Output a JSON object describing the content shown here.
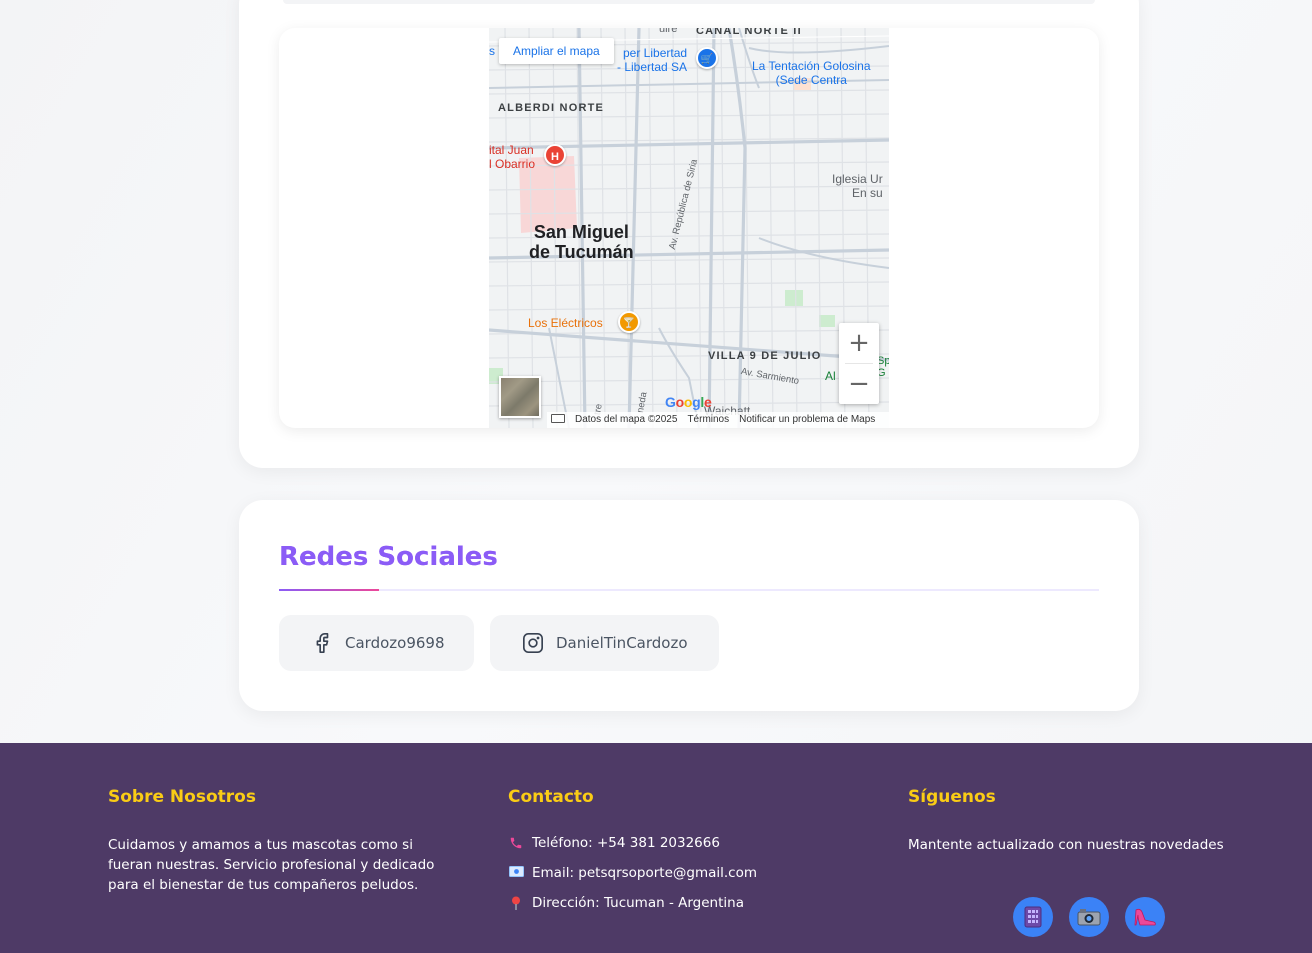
{
  "map": {
    "expand_label": "Ampliar el mapa",
    "labels": {
      "canal_norte": "CANAL NORTE II",
      "super_libertad": "per Libertad\n- Libertad SA",
      "tentacion": "La Tentación Golosina\n(Sede Centra",
      "alberdi_norte": "ALBERDI NORTE",
      "hospital": "ital Juan\nl Obarrio",
      "city": "San Miguel\nde Tucumán",
      "iglesia": "Iglesia Ur\nEn su",
      "republica_siria": "Av. República de Siria",
      "los_electricos": "Los Eléctricos",
      "villa_9_julio": "VILLA 9 DE JULIO",
      "sarmiento": "Av. Sarmiento",
      "al": "Al",
      "waichatt": "Waichatt",
      "sp": "Sp\nG",
      "tre": "tre",
      "neda": "neda",
      "s_left": "s",
      "top_guire": "uire"
    },
    "pins": {
      "hospital": "H",
      "shop": "🛒",
      "bar": "🍸"
    },
    "zoom_in": "+",
    "zoom_out": "−",
    "google_logo": "Google",
    "attribution": {
      "map_data": "Datos del mapa ©2025",
      "terms": "Términos",
      "report": "Notificar un problema de Maps"
    }
  },
  "social": {
    "title": "Redes Sociales",
    "facebook": {
      "label": "Cardozo9698",
      "icon": "facebook-icon"
    },
    "instagram": {
      "label": "DanielTinCardozo",
      "icon": "instagram-icon"
    }
  },
  "footer": {
    "about": {
      "title": "Sobre Nosotros",
      "text": "Cuidamos y amamos a tus mascotas como si fueran nuestras. Servicio profesional y dedicado para el bienestar de tus compañeros peludos."
    },
    "contact": {
      "title": "Contacto",
      "phone": "Teléfono: +54 381 2032666",
      "email": "Email: petsqrsoporte@gmail.com",
      "address": "Dirección: Tucuman - Argentina"
    },
    "follow": {
      "title": "Síguenos",
      "text": "Mantente actualizado con nuestras novedades",
      "icons": [
        "phone-app-icon",
        "camera-icon",
        "heel-icon"
      ]
    }
  },
  "colors": {
    "accent_purple": "#8b5cf6",
    "footer_bg": "#4e3a66",
    "footer_title": "#facc15",
    "social_round": "#3b82f6"
  }
}
